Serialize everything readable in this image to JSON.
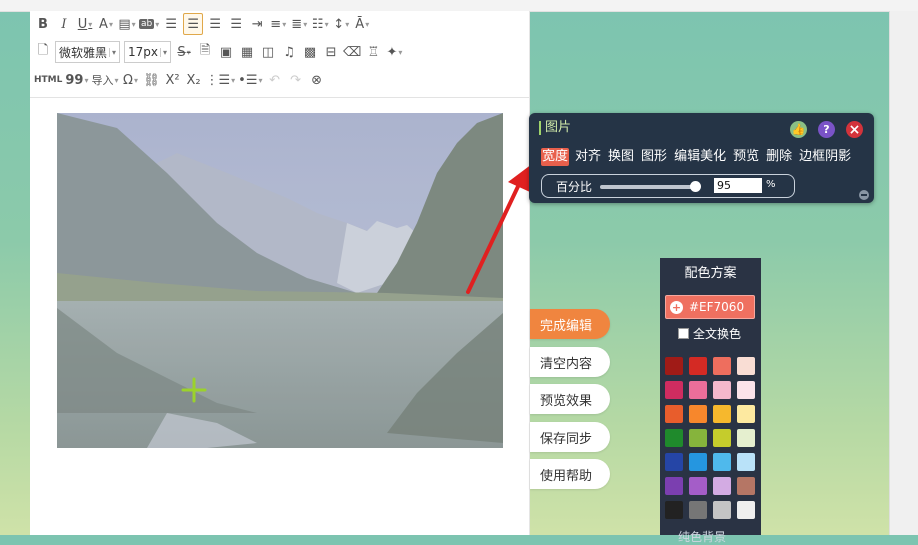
{
  "toolbar": {
    "font_family": "微软雅黑",
    "font_size": "17px",
    "html_label": "HTML",
    "import_label": "导入",
    "row1_icons": [
      "bold-icon",
      "italic-icon",
      "underline-icon",
      "font-color-icon",
      "background-color-icon",
      "format-icon",
      "align-left-icon",
      "align-center-icon",
      "align-right-icon",
      "align-justify-icon",
      "indent-icon",
      "line-height-icon",
      "paragraph-spacing-icon",
      "list-style-icon",
      "letter-spacing-icon",
      "clear-format-icon"
    ],
    "row2_icons": [
      "document-icon",
      "strikethrough-icon",
      "word-icon",
      "image-icon",
      "table-icon",
      "gallery-icon",
      "music-icon",
      "video-icon",
      "divider-icon",
      "eraser-icon",
      "stamp-icon",
      "magic-icon"
    ],
    "row3_icons": [
      "quote-icon",
      "omega-icon",
      "link-icon",
      "superscript-icon",
      "subscript-icon",
      "ordered-list-icon",
      "unordered-list-icon",
      "undo-icon",
      "redo-icon",
      "find-icon"
    ],
    "labels": {
      "bold": "B",
      "italic": "I",
      "underline": "U",
      "font_color": "A",
      "superscript": "X²",
      "subscript": "X₂",
      "omega": "Ω",
      "quote": "99"
    }
  },
  "image_panel": {
    "title": "图片",
    "tabs": [
      "宽度",
      "对齐",
      "换图",
      "图形",
      "编辑美化",
      "预览",
      "删除",
      "边框阴影"
    ],
    "active_tab": "宽度",
    "percent_label": "百分比",
    "percent_value": "95",
    "percent_unit": "%",
    "icons": {
      "thumb": "👍",
      "help": "?",
      "close": "×"
    }
  },
  "side_buttons": [
    "完成编辑",
    "清空内容",
    "预览效果",
    "保存同步",
    "使用帮助"
  ],
  "color_scheme": {
    "title": "配色方案",
    "current": "#EF7060",
    "full_text_label": "全文换色",
    "swatches": [
      "#a01b17",
      "#d42a24",
      "#ee6e5e",
      "#f9ddd4",
      "#cf2c60",
      "#ec6e9a",
      "#f4b8cc",
      "#fbe3ea",
      "#e85d2c",
      "#f7872c",
      "#f6b82d",
      "#fde9a0",
      "#1f8a2c",
      "#86b43c",
      "#c5cc2c",
      "#e5efcf",
      "#2545a6",
      "#2596e0",
      "#4fb9ec",
      "#b9e2f9",
      "#7b3fb0",
      "#a45dc8",
      "#d3abe3",
      "#b57665",
      "#222222",
      "#767676",
      "#c4c4c4",
      "#efefef"
    ],
    "cutoff_label": "纯色背景"
  }
}
